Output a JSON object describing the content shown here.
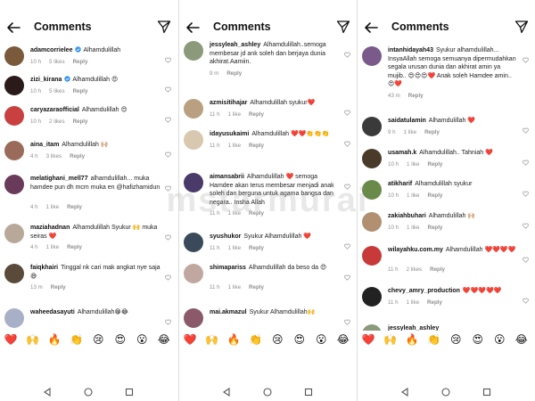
{
  "header": {
    "title": "Comments"
  },
  "watermark": "mstarmurai",
  "emoji_bar": [
    "❤️",
    "🙌",
    "🔥",
    "👏",
    "😢",
    "😍",
    "😮",
    "😂"
  ],
  "columns": [
    {
      "comments": [
        {
          "user": "adamcorrielee",
          "verified": true,
          "text": "Alhamdulillah",
          "time": "10 h",
          "likes": "5 likes",
          "reply": "Reply",
          "avatar_color": "#7a5a3a"
        },
        {
          "user": "zizi_kirana",
          "verified": true,
          "text": "Alhamdulillah 😍",
          "time": "10 h",
          "likes": "5 likes",
          "reply": "Reply",
          "avatar_color": "#2a1a1a"
        },
        {
          "user": "caryazaraofficial",
          "verified": false,
          "text": "Alhamdulillah 😍",
          "time": "10 h",
          "likes": "2 likes",
          "reply": "Reply",
          "avatar_color": "#c94040"
        },
        {
          "user": "aina_itam",
          "verified": false,
          "text": "Alhamdulillah 🙌🏼",
          "time": "4 h",
          "likes": "3 likes",
          "reply": "Reply",
          "avatar_color": "#9a6b5a"
        },
        {
          "user": "melatighani_mell77",
          "verified": false,
          "text": "alhamdulillah... muka hamdee pun dh mcm muka en @hafizhamidun",
          "time": "4 h",
          "likes": "1 like",
          "reply": "Reply",
          "avatar_color": "#6a3a5a"
        },
        {
          "user": "maziahadnan",
          "verified": false,
          "text": "Alhamdulillah Syukur 🙌 muka seiras ❤️",
          "time": "4 h",
          "likes": "1 like",
          "reply": "Reply",
          "avatar_color": "#b8a89a"
        },
        {
          "user": "faiqkhairi",
          "verified": false,
          "text": "Tinggal nk cari mak angkat nye saja 😄",
          "time": "13 m",
          "likes": "",
          "reply": "Reply",
          "avatar_color": "#5a4a3a"
        },
        {
          "user": "waheedasayuti",
          "verified": false,
          "text": "Alhamdulillah😁😂",
          "time": "",
          "likes": "",
          "reply": "",
          "avatar_color": "#a8b0c8"
        }
      ]
    },
    {
      "comments": [
        {
          "user": "jessyleah_ashley",
          "verified": false,
          "text": "Alhamdulillah..semoga membesar jd ank soleh dan berjaya dunia akhirat.Aamiin.",
          "time": "9 m",
          "likes": "",
          "reply": "Reply",
          "avatar_color": "#8a9a7a"
        },
        {
          "user": "azmisitihajar",
          "verified": false,
          "text": "Alhamdulillah syukur❤️",
          "time": "11 h",
          "likes": "1 like",
          "reply": "Reply",
          "avatar_color": "#b8a080"
        },
        {
          "user": "idayusukaimi",
          "verified": false,
          "text": "Alhamdulillah ❤️❤️👏👏👏",
          "time": "11 h",
          "likes": "1 like",
          "reply": "Reply",
          "avatar_color": "#d8c8b0"
        },
        {
          "user": "aimansabrii",
          "verified": false,
          "text": "Alhamdulillah ❤️ semoga Hamdee akan terus membesar menjadi anak soleh dan berguna untuk agama bangsa dan negara.. Insha Allah",
          "time": "11 h",
          "likes": "1 like",
          "reply": "Reply",
          "avatar_color": "#4a3a6a"
        },
        {
          "user": "syushukor",
          "verified": false,
          "text": "Syukur Alhamdulillah ❤️",
          "time": "11 h",
          "likes": "1 like",
          "reply": "Reply",
          "avatar_color": "#3a4a5a"
        },
        {
          "user": "shimapariss",
          "verified": false,
          "text": "Alhamdulillah da beso da 😍",
          "time": "11 h",
          "likes": "1 like",
          "reply": "Reply",
          "avatar_color": "#c0a8a0"
        },
        {
          "user": "mai.akmazul",
          "verified": false,
          "text": "Syukur Alhamdulillah🙌",
          "time": "",
          "likes": "",
          "reply": "",
          "avatar_color": "#8a5a6a"
        }
      ]
    },
    {
      "comments": [
        {
          "user": "intanhidayah43",
          "verified": false,
          "text": "Syukur alhamdulillah... InsyaAllah semoga semuanya dipermudahkan segala urusan dunia dan akhirat amin ya mujib.. 😍😍😍❤️ Anak soleh Hamdee amin..😍❤️",
          "time": "43 m",
          "likes": "",
          "reply": "Reply",
          "avatar_color": "#7a5a8a"
        },
        {
          "user": "saidatulamin",
          "verified": false,
          "text": "Alhamdulillah ❤️",
          "time": "9 h",
          "likes": "1 like",
          "reply": "Reply",
          "avatar_color": "#3a3a3a"
        },
        {
          "user": "usamah.k",
          "verified": false,
          "text": "Alhamdulillah.. Tahniah ❤️",
          "time": "10 h",
          "likes": "1 like",
          "reply": "Reply",
          "avatar_color": "#4a3a2a"
        },
        {
          "user": "atikharif",
          "verified": false,
          "text": "Alhamdulillah syukur",
          "time": "10 h",
          "likes": "1 like",
          "reply": "Reply",
          "avatar_color": "#6a8a4a"
        },
        {
          "user": "zakiahbuhari",
          "verified": false,
          "text": "Alhamdulillah 🙌🏼",
          "time": "10 h",
          "likes": "1 like",
          "reply": "Reply",
          "avatar_color": "#b09070"
        },
        {
          "user": "wilayahku.com.my",
          "verified": false,
          "text": "Alhamdulillah ❤️❤️❤️❤️",
          "time": "11 h",
          "likes": "2 likes",
          "reply": "Reply",
          "avatar_color": "#c83a3a"
        },
        {
          "user": "chevy_amry_production",
          "verified": false,
          "text": "❤️❤️❤️❤️❤️",
          "time": "11 h",
          "likes": "1 like",
          "reply": "Reply",
          "avatar_color": "#222222"
        },
        {
          "user": "jessyleah_ashley",
          "verified": false,
          "text": "",
          "time": "",
          "likes": "",
          "reply": "",
          "avatar_color": "#8a9a7a"
        }
      ]
    }
  ]
}
